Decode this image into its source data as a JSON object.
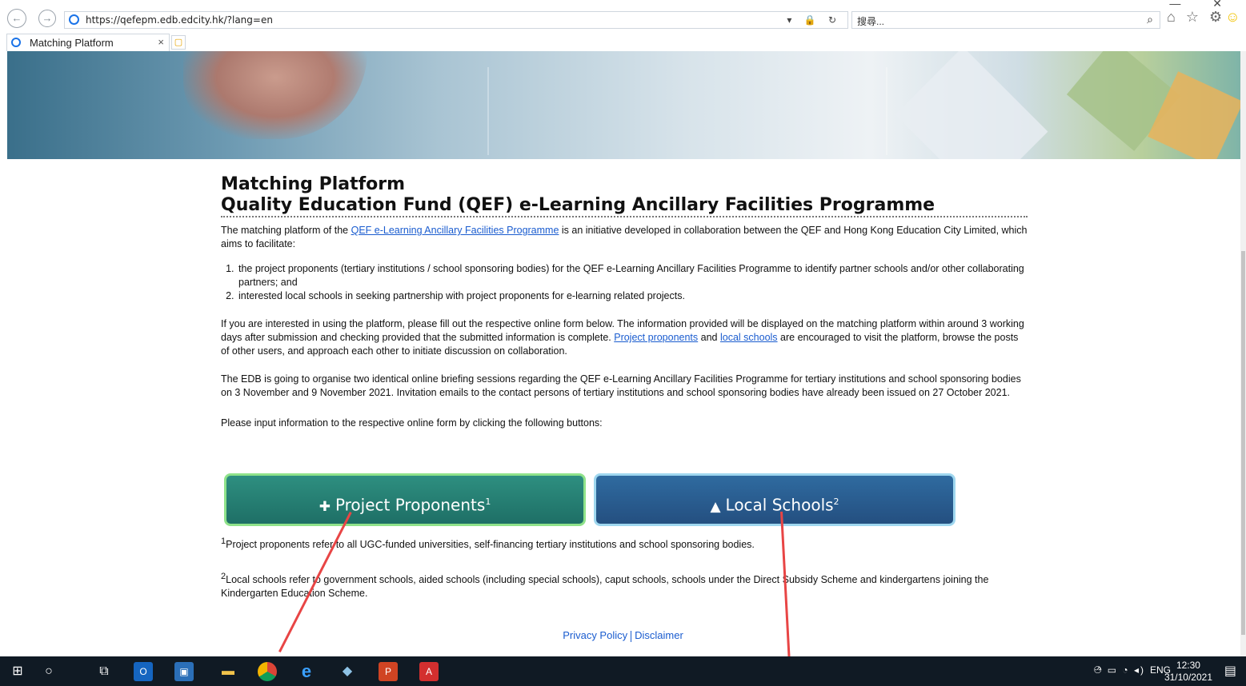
{
  "browser": {
    "url": "https://qefepm.edb.edcity.hk/?lang=en",
    "search_placeholder": "搜尋...",
    "tab_title": "Matching Platform",
    "tab_close": "×",
    "nav_back": "←",
    "nav_forward": "→",
    "search_icon": "search-icon",
    "addr_icons": "▾ 🔒 ↻",
    "toolbar_glyphs": "⌂ ☆ ⚙",
    "smile_glyph": "☺",
    "window_controls": "— ✕"
  },
  "page": {
    "title_line1": "Matching Platform",
    "title_line2": "Quality Education Fund (QEF) e-Learning Ancillary Facilities Programme",
    "intro_before": "The matching platform of the ",
    "intro_link": "QEF e-Learning Ancillary Facilities Programme",
    "intro_after": " is an initiative developed in collaboration between the QEF and Hong Kong Education City Limited, which aims to facilitate:",
    "list": [
      "the project proponents (tertiary institutions / school sponsoring bodies) for the QEF e-Learning Ancillary Facilities Programme to identify partner schools and/or other collaborating partners; and",
      "interested local schools in seeking partnership with project proponents for e-learning related projects."
    ],
    "para2_before": "If you are interested in using the platform, please fill out the respective online form below. The information provided will be displayed on the matching platform within around 3 working days after submission and checking provided that the submitted information is complete. ",
    "para2_link1": "Project proponents",
    "para2_mid": " and ",
    "para2_link2": "local schools",
    "para2_after": " are encouraged to visit the platform, browse the posts of other users, and approach each other to initiate discussion on collaboration.",
    "para3": "The EDB is going to organise two identical online briefing sessions regarding the QEF e-Learning Ancillary Facilities Programme for tertiary institutions and school sponsoring bodies on 3 November and 9 November 2021. Invitation emails to the contact persons of tertiary institutions and school sponsoring bodies have already been issued on 27 October 2021.",
    "para4": "Please input information to the respective online form by clicking the following buttons:",
    "button_pp": "Project Proponents",
    "button_pp_sup": "1",
    "button_ls": "Local Schools",
    "button_ls_sup": "2",
    "fn1_sup": "1",
    "fn1": "Project proponents refer to all UGC-funded universities, self-financing tertiary institutions and school sponsoring bodies.",
    "fn2_sup": "2",
    "fn2": "Local schools refer to government schools, aided schools (including special schools), caput schools, schools under the Direct Subsidy Scheme and kindergartens joining the Kindergarten Education Scheme.",
    "privacy": "Privacy Policy",
    "disclaimer": "Disclaimer"
  },
  "taskbar": {
    "lang": "ENG",
    "time": "12:30",
    "date": "31/10/2021",
    "tray_glyphs": "^ ▭ ◔ ◂)",
    "windows_glyph": "⊞",
    "search_glyph": "○",
    "taskview_glyph": "⧉",
    "outlook_glyph": "O",
    "app_glyph": "▣",
    "files_glyph": "▬",
    "ie_glyph": "e",
    "store_glyph": "◆",
    "ppt_glyph": "P",
    "pdf_glyph": "A",
    "person_glyph": "⚇",
    "notif_glyph": "▤"
  }
}
